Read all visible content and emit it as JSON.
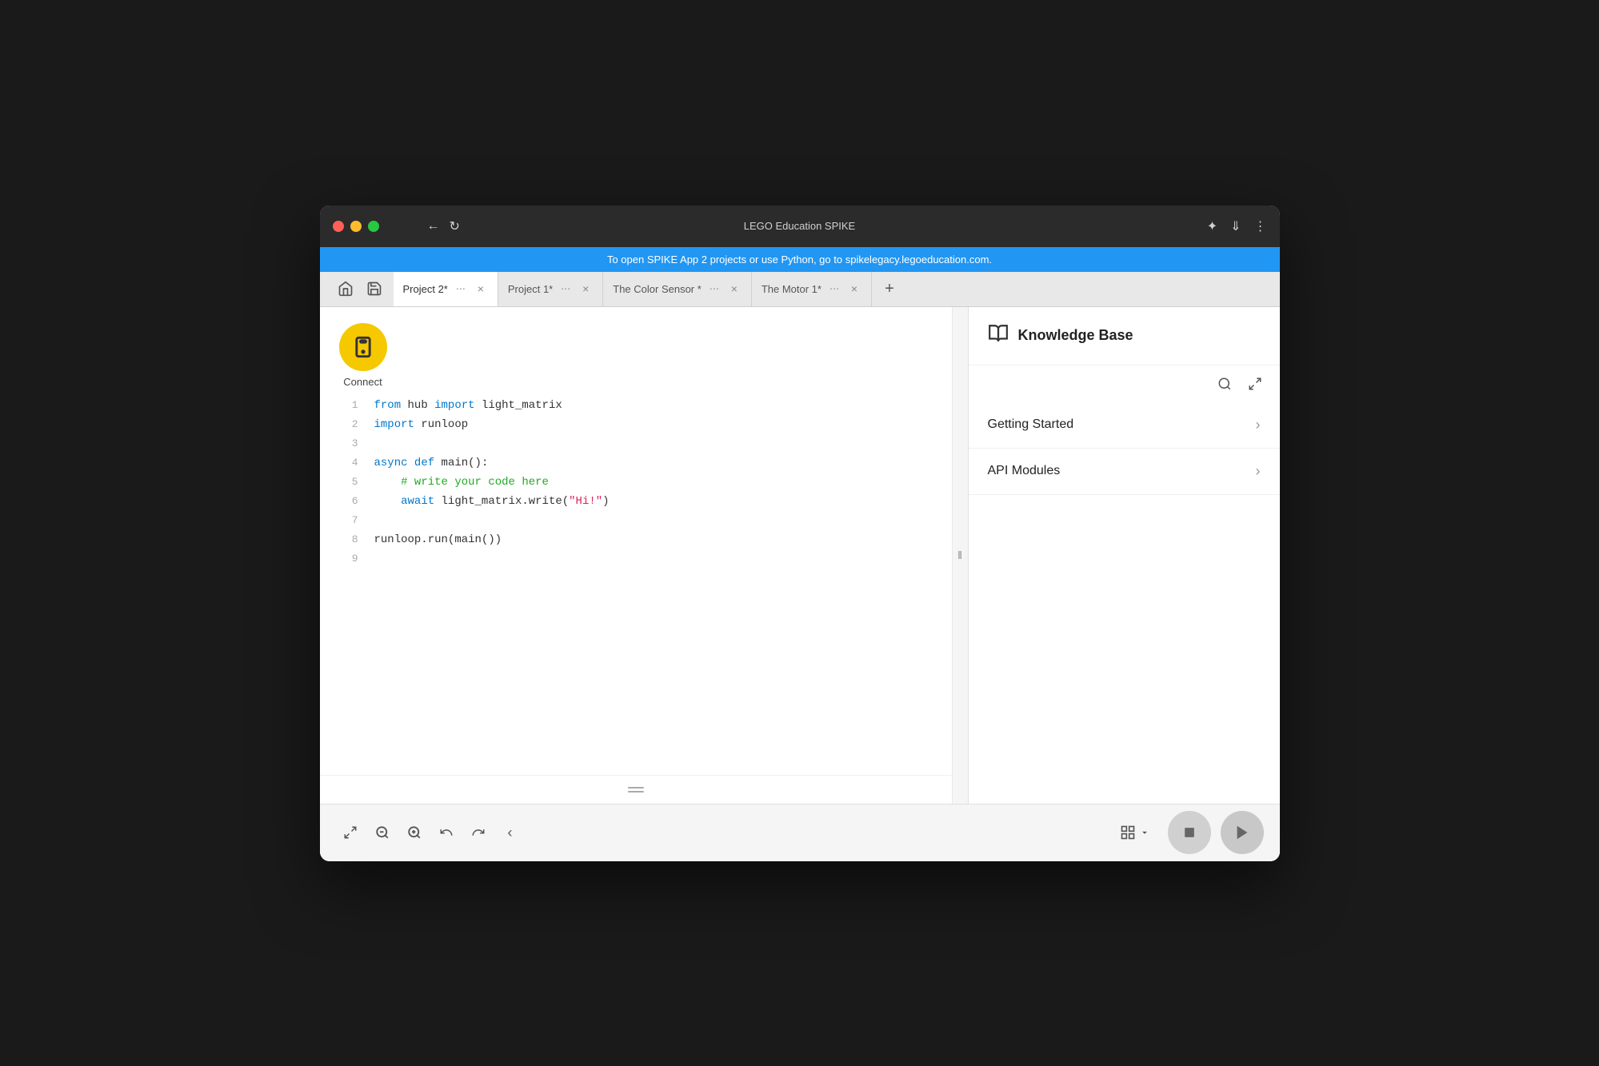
{
  "window": {
    "title": "LEGO Education SPIKE"
  },
  "banner": {
    "text": "To open SPIKE App 2 projects or use Python, go to spikelegacy.legoeducation.com."
  },
  "tabs": [
    {
      "label": "Project 2*",
      "active": true
    },
    {
      "label": "Project 1*",
      "active": false
    },
    {
      "label": "The Color Sensor *",
      "active": false
    },
    {
      "label": "The Motor 1*",
      "active": false
    }
  ],
  "connect": {
    "label": "Connect"
  },
  "code": {
    "lines": [
      {
        "num": "1",
        "content": "from_hub_import_light_matrix"
      },
      {
        "num": "2",
        "content": "import_runloop"
      },
      {
        "num": "3",
        "content": ""
      },
      {
        "num": "4",
        "content": "async_def_main"
      },
      {
        "num": "5",
        "content": "comment_write_code"
      },
      {
        "num": "6",
        "content": "await_light_matrix"
      },
      {
        "num": "7",
        "content": ""
      },
      {
        "num": "8",
        "content": "runloop_run"
      },
      {
        "num": "9",
        "content": ""
      }
    ]
  },
  "knowledge": {
    "title": "Knowledge Base",
    "items": [
      {
        "label": "Getting Started"
      },
      {
        "label": "API Modules"
      }
    ]
  },
  "toolbar": {
    "fullscreen_label": "⛶",
    "zoom_out_label": "−",
    "zoom_in_label": "+",
    "undo_label": "↩",
    "redo_label": "↪",
    "collapse_label": "‹",
    "grid_label": "⊞",
    "stop_label": "■",
    "play_label": "▶"
  }
}
